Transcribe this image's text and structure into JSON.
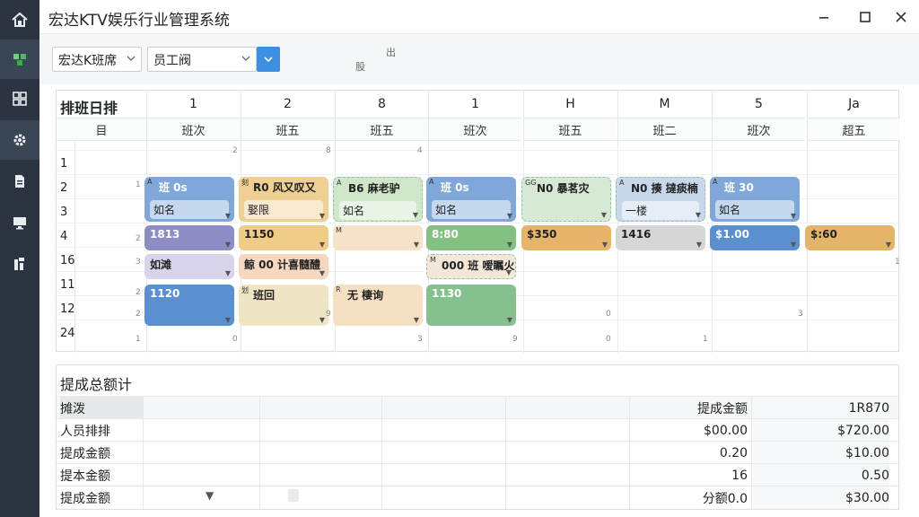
{
  "app": {
    "title": "宏达KTV娱乐行业管理系统"
  },
  "sidebar": {
    "items": [
      {
        "icon": "home-icon"
      },
      {
        "icon": "cube-icon"
      },
      {
        "icon": "grid-icon"
      },
      {
        "icon": "gear-icon"
      },
      {
        "icon": "document-icon"
      },
      {
        "icon": "monitor-icon"
      },
      {
        "icon": "chart-icon"
      }
    ]
  },
  "toolbar": {
    "store_select": "宏达K班席",
    "staff_select": "员工阀",
    "note_top": "出",
    "note_bottom": "股"
  },
  "schedule": {
    "title": "排班日排",
    "columns": [
      "1",
      "2",
      "8",
      "1",
      "H",
      "M",
      "5",
      "Ja"
    ],
    "sub_first": "目",
    "sub_headers": [
      "班次",
      "班五",
      "班五",
      "班次",
      "班五",
      "班二",
      "班次",
      "超五"
    ],
    "rows": [
      "1",
      "2",
      "3",
      "4",
      "16",
      "11",
      "12",
      "24"
    ],
    "chips": [
      {
        "line1": "班 0s",
        "line2": "如名",
        "prefix": "A",
        "color": "#7fa8d8"
      },
      {
        "line1": "R0 风又叹又",
        "line2": "娶限",
        "prefix": "刻",
        "color": "#f0cf94"
      },
      {
        "line1": "B6 麻老驴",
        "line2": "如名",
        "prefix": "A",
        "color": "#cfe6c8"
      },
      {
        "line1": "班 0s",
        "line2": "如名",
        "prefix": "A",
        "color": "#7fa8d8"
      },
      {
        "line1": "N0 暴茗灾",
        "line2": "",
        "prefix": "GG",
        "color": "#d5e9d5"
      },
      {
        "line1": "N0 揍 撻痰楠",
        "line2": "一楼",
        "prefix": "A",
        "color": "#c8d8ec"
      },
      {
        "line1": "班 30",
        "line2": "如名",
        "prefix": "A",
        "color": "#7fa8d8"
      },
      {
        "line1": "1813",
        "prefix": "",
        "color": "#8e8cc4"
      },
      {
        "line1": "1150",
        "prefix": "",
        "color": "#f0cc88"
      },
      {
        "line1": "",
        "prefix": "M",
        "color": "#f6e2c8"
      },
      {
        "line1": "8:80",
        "prefix": "",
        "color": "#84c084"
      },
      {
        "line1": "$350",
        "prefix": "",
        "color": "#e6b46a"
      },
      {
        "line1": "1416",
        "prefix": "",
        "color": "#d6d6d6"
      },
      {
        "line1": "$1.00",
        "prefix": "",
        "color": "#5a90d0"
      },
      {
        "line1": "$:60",
        "prefix": "",
        "color": "#e4b46a"
      },
      {
        "line1": "鲸 00 计喜髓醴",
        "prefix": "",
        "color": "#f6d8c0"
      },
      {
        "line1": "000 班 嗳瞩火",
        "prefix": "M",
        "color": "#f3e8d8"
      },
      {
        "line1": "1120",
        "prefix": "",
        "color": "#5a90d0"
      },
      {
        "line1": "班回",
        "prefix": "划",
        "color": "#efe4c4"
      },
      {
        "line1": "无 棲询",
        "prefix": "R",
        "color": "#f6e0c4"
      },
      {
        "line1": "1130",
        "prefix": "",
        "color": "#86c08e"
      },
      {
        "line1": "如滩",
        "prefix": "",
        "color": "#d8d4ec"
      }
    ],
    "cell_numbers": [
      "2",
      "8",
      "4",
      "1",
      "2",
      "3",
      "2",
      "2",
      "9",
      "3",
      "9",
      "0",
      "0",
      "1",
      "3",
      "1",
      "0",
      "1"
    ]
  },
  "summary": {
    "title": "提成总额计",
    "header": {
      "label": "摊泼",
      "amount_label": "提成金额",
      "total": "1R870"
    },
    "rows": [
      {
        "label": "人员排排",
        "value": "$00.00",
        "total": "$720.00"
      },
      {
        "label": "提成金额",
        "value": "0.20",
        "total": "$10.00"
      },
      {
        "label": "提本金额",
        "value": "16",
        "total": "0.50"
      },
      {
        "label": "提成金额",
        "value": "分额0.0",
        "total": "$30.00"
      }
    ]
  }
}
